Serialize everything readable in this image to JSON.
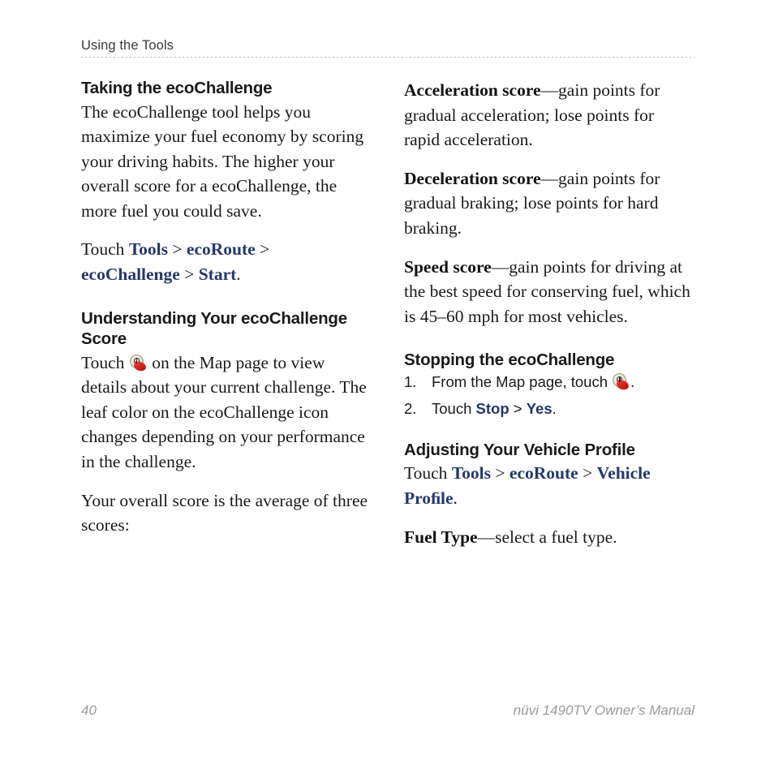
{
  "page": {
    "running_header": "Using the Tools",
    "page_number": "40",
    "manual_title": "nüvi 1490TV Owner’s Manual",
    "link_color": "#24386b",
    "text_color": "#1a1a1a",
    "footer_color": "#9a9a9a",
    "rule_color": "#b9b9b9",
    "background": "#ffffff"
  },
  "left_column": {
    "heading_1": "Taking the ecoChallenge",
    "para_1": "The ecoChallenge tool helps you maximize your fuel economy by scoring your driving habits. The higher your overall score for a ecoChallenge, the more fuel you could save.",
    "touch_path_1": {
      "prefix": "Touch ",
      "link_1": "Tools",
      "sep_1": " > ",
      "link_2": "ecoRoute",
      "sep_2": " > ",
      "link_3": "ecoChallenge",
      "sep_3": " > ",
      "link_4": "Start",
      "suffix": "."
    },
    "heading_2": "Understanding Your ecoChallenge Score",
    "para_2_before_icon": "Touch ",
    "para_2_icon": "ecochallenge-leaf-icon",
    "para_2_after_icon": " on the Map page to view details about your current challenge. The leaf color on the ecoChallenge icon changes depending on your performance in the challenge.",
    "para_3": "Your overall score is the average of three scores:"
  },
  "right_column": {
    "score_items": [
      {
        "term": "Acceleration score",
        "dash": "—",
        "definition": "gain points for gradual acceleration; lose points for rapid acceleration."
      },
      {
        "term": "Deceleration score",
        "dash": "—",
        "definition": "gain points for gradual braking; lose points for hard braking."
      },
      {
        "term": "Speed score",
        "dash": "—",
        "definition": "gain points for driving at the best speed for conserving fuel, which is 45–60 mph for most vehicles."
      }
    ],
    "heading_stopping": "Stopping the ecoChallenge",
    "steps": [
      {
        "number": "1.",
        "text_before_icon": "From the Map page, touch ",
        "icon": "ecochallenge-leaf-icon",
        "text_after_icon": "."
      },
      {
        "number": "2.",
        "text_before": "Touch ",
        "link_1": "Stop",
        "sep_1": " > ",
        "link_2": "Yes",
        "text_after": "."
      }
    ],
    "heading_vehicle": "Adjusting Your Vehicle Profile",
    "touch_path_2": {
      "prefix": "Touch ",
      "link_1": "Tools",
      "sep_1": " > ",
      "link_2": "ecoRoute",
      "sep_2": " > ",
      "link_3": "Vehicle Proﬁle",
      "suffix": "."
    },
    "fuel_type": {
      "term": "Fuel Type",
      "dash": "—",
      "definition": "select a fuel type."
    }
  }
}
